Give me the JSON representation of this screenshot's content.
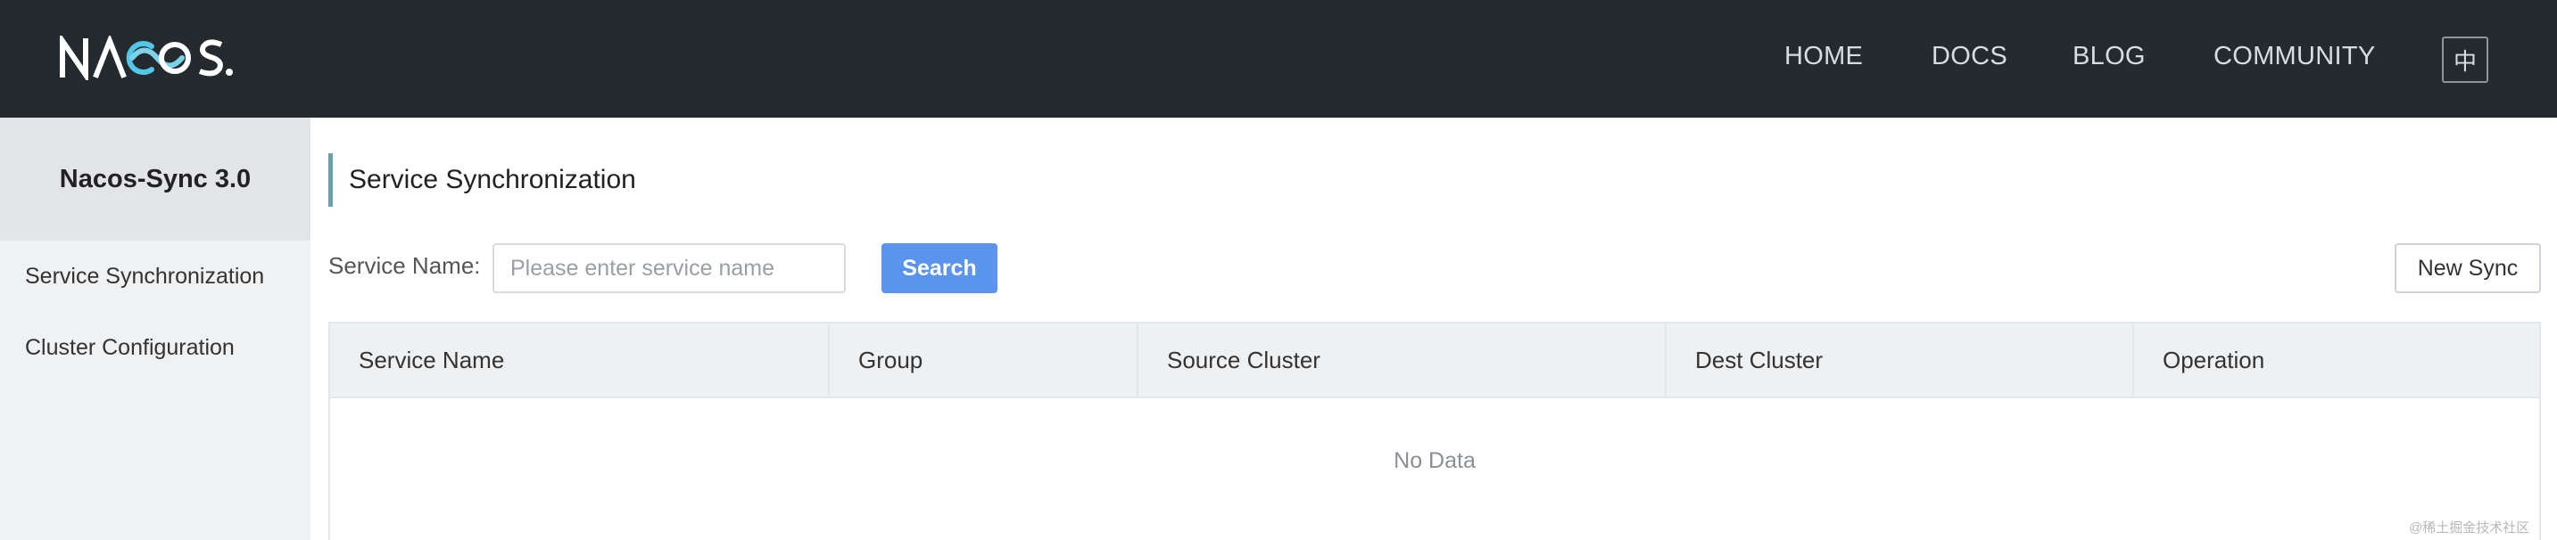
{
  "header": {
    "logo_text": "NACOS.",
    "nav": [
      "HOME",
      "DOCS",
      "BLOG",
      "COMMUNITY"
    ],
    "lang_toggle": "中",
    "colors": {
      "background": "#252a2f",
      "nav_text": "#d9dde2"
    }
  },
  "sidebar": {
    "title": "Nacos-Sync 3.0",
    "items": [
      {
        "label": "Service Synchronization"
      },
      {
        "label": "Cluster Configuration"
      }
    ]
  },
  "main": {
    "page_title": "Service Synchronization",
    "filter": {
      "label": "Service Name:",
      "placeholder": "Please enter service name",
      "value": ""
    },
    "search_label": "Search",
    "new_sync_label": "New Sync",
    "table": {
      "columns": [
        "Service Name",
        "Group",
        "Source Cluster",
        "Dest Cluster",
        "Operation"
      ],
      "rows": [],
      "empty_text": "No Data"
    },
    "colors": {
      "accent": "#5b94ec",
      "title_bar": "#6a9fb0"
    }
  },
  "watermark": "@稀土掘金技术社区"
}
